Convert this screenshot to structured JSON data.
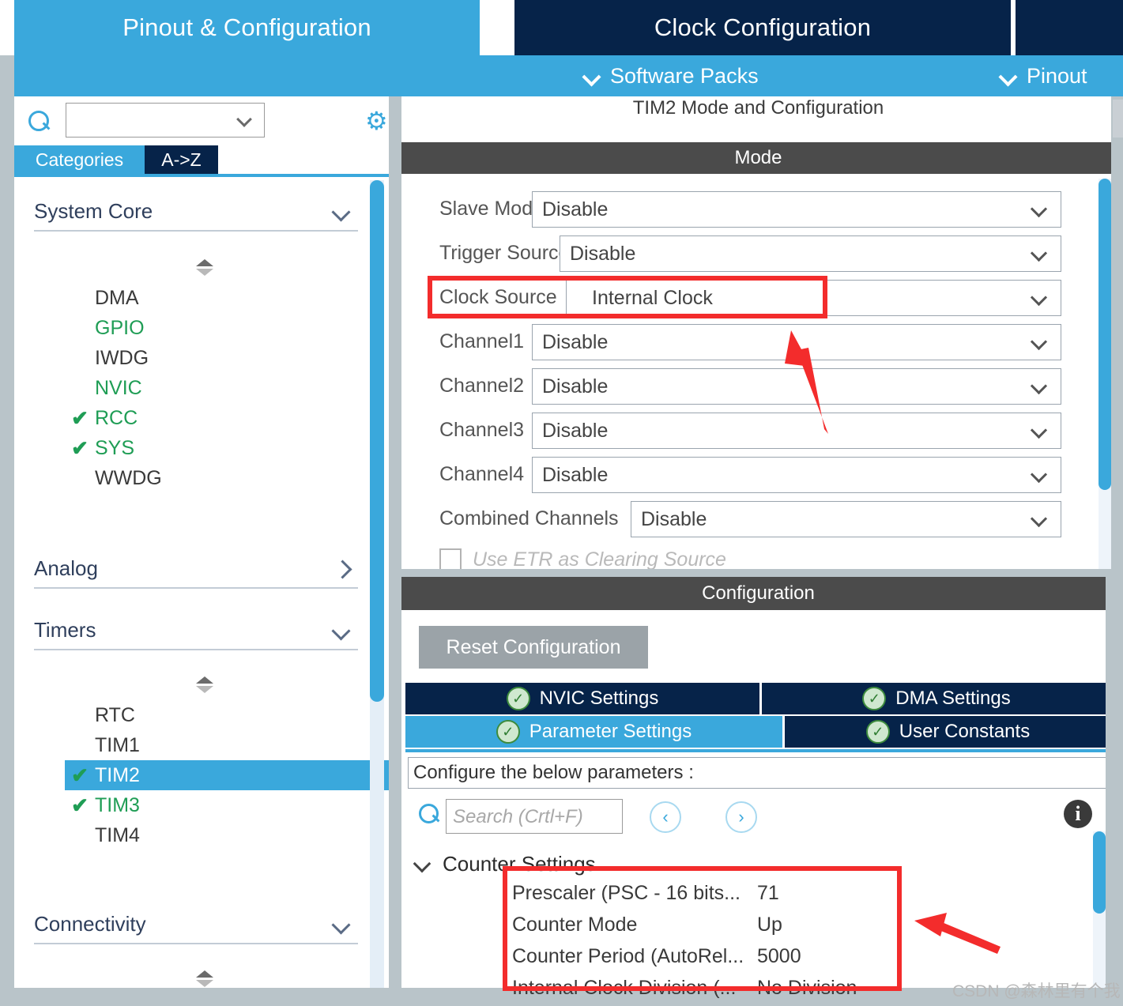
{
  "topbar": {
    "tabs": [
      {
        "label": "Pinout & Configuration",
        "selected": true
      },
      {
        "label": "Clock Configuration",
        "selected": false
      }
    ],
    "software_packs": "Software Packs",
    "pinout": "Pinout"
  },
  "sidebar": {
    "search_placeholder": "",
    "search_value": "",
    "gear_icon": "gear-icon",
    "tabs": [
      {
        "label": "Categories",
        "selected": true
      },
      {
        "label": "A->Z",
        "selected": false
      }
    ],
    "groups": [
      {
        "title": "System Core",
        "expanded": true,
        "items": [
          {
            "label": "DMA",
            "state": "none"
          },
          {
            "label": "GPIO",
            "state": "configured"
          },
          {
            "label": "IWDG",
            "state": "none"
          },
          {
            "label": "NVIC",
            "state": "configured"
          },
          {
            "label": "RCC",
            "state": "checked"
          },
          {
            "label": "SYS",
            "state": "checked"
          },
          {
            "label": "WWDG",
            "state": "none"
          }
        ]
      },
      {
        "title": "Analog",
        "expanded": false,
        "items": []
      },
      {
        "title": "Timers",
        "expanded": true,
        "items": [
          {
            "label": "RTC",
            "state": "none"
          },
          {
            "label": "TIM1",
            "state": "none"
          },
          {
            "label": "TIM2",
            "state": "checked",
            "selected": true
          },
          {
            "label": "TIM3",
            "state": "checked"
          },
          {
            "label": "TIM4",
            "state": "none"
          }
        ]
      },
      {
        "title": "Connectivity",
        "expanded": true,
        "items": []
      }
    ]
  },
  "mode_panel": {
    "title": "TIM2 Mode and Configuration",
    "header": "Mode",
    "fields": [
      {
        "label": "Slave Mode",
        "value": "Disable"
      },
      {
        "label": "Trigger Source",
        "value": "Disable"
      },
      {
        "label": "Clock Source",
        "value": "Internal Clock",
        "highlighted": true
      },
      {
        "label": "Channel1",
        "value": "Disable"
      },
      {
        "label": "Channel2",
        "value": "Disable"
      },
      {
        "label": "Channel3",
        "value": "Disable"
      },
      {
        "label": "Channel4",
        "value": "Disable"
      },
      {
        "label": "Combined Channels",
        "value": "Disable"
      }
    ],
    "checkbox": {
      "label": "Use ETR as Clearing Source",
      "checked": false
    }
  },
  "config_panel": {
    "header": "Configuration",
    "reset_label": "Reset Configuration",
    "tabs": [
      {
        "label": "NVIC Settings",
        "active": false
      },
      {
        "label": "DMA Settings",
        "active": false
      },
      {
        "label": "Parameter Settings",
        "active": true
      },
      {
        "label": "User Constants",
        "active": false
      }
    ],
    "configure_hint": "Configure the below parameters :",
    "search_placeholder": "Search (Crtl+F)",
    "search_value": "",
    "nav_prev": "‹",
    "nav_next": "›",
    "info_icon": "info-icon",
    "section": {
      "title": "Counter Settings",
      "expanded": true,
      "rows": [
        {
          "name": "Prescaler (PSC - 16 bits...",
          "value": "71"
        },
        {
          "name": "Counter Mode",
          "value": "Up"
        },
        {
          "name": "Counter Period (AutoRel...",
          "value": "5000"
        },
        {
          "name": "Internal Clock Division (...",
          "value": "No Division"
        }
      ]
    }
  },
  "colors": {
    "accent_blue": "#3aa8dc",
    "dark_navy": "#062349",
    "header_gray": "#4b4b4b",
    "annotation_red": "#f32c2c",
    "check_green": "#1f9d55"
  },
  "watermark": "CSDN @森林里有个我"
}
